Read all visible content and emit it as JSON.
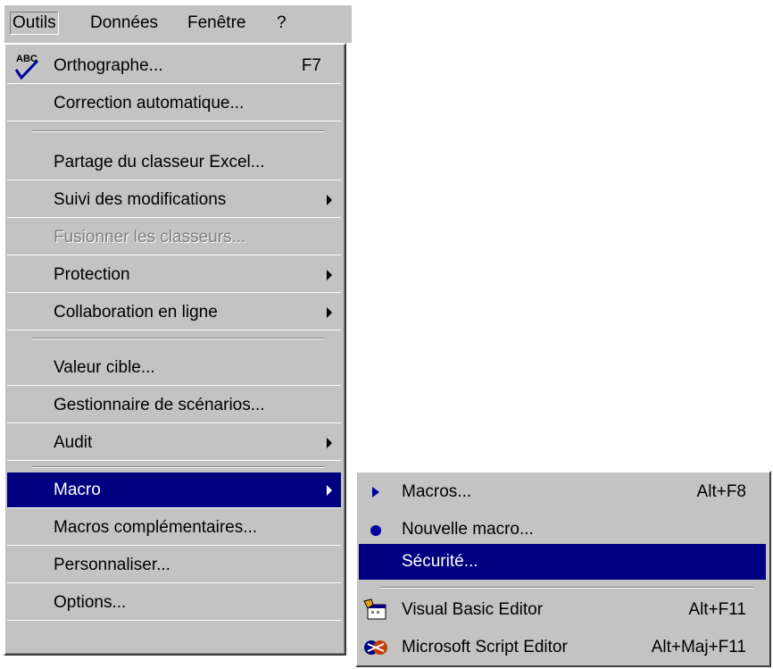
{
  "menubar": {
    "items": [
      {
        "label": "Outils",
        "ul": "O"
      },
      {
        "label": "Données",
        "ul": "D"
      },
      {
        "label": "Fenêtre",
        "ul": "n"
      },
      {
        "label": "?",
        "ul": "?"
      }
    ]
  },
  "menu": {
    "items": [
      {
        "label": "Orthographe...",
        "shortcut": "F7"
      },
      {
        "label": "Correction automatique..."
      },
      {
        "label": "Partage du classeur Excel..."
      },
      {
        "label": "Suivi des modifications"
      },
      {
        "label": "Fusionner les classeurs..."
      },
      {
        "label": "Protection"
      },
      {
        "label": "Collaboration en ligne"
      },
      {
        "label": "Valeur cible..."
      },
      {
        "label": "Gestionnaire de scénarios..."
      },
      {
        "label": "Audit"
      },
      {
        "label": "Macro"
      },
      {
        "label": "Macros complémentaires..."
      },
      {
        "label": "Personnaliser..."
      },
      {
        "label": "Options..."
      }
    ]
  },
  "submenu": {
    "items": [
      {
        "label": "Macros...",
        "shortcut": "Alt+F8"
      },
      {
        "label": "Nouvelle macro..."
      },
      {
        "label": "Sécurité..."
      },
      {
        "label": "Visual Basic Editor",
        "shortcut": "Alt+F11"
      },
      {
        "label": "Microsoft Script Editor",
        "shortcut": "Alt+Maj+F11"
      }
    ]
  },
  "icons": {
    "spelling": "abc-check-icon",
    "macros": "play-triangle-icon",
    "record": "record-dot-icon",
    "vbe": "vba-editor-icon",
    "script": "script-editor-icon"
  },
  "colors": {
    "menu_bg": "#c3c3c3",
    "highlight": "#000080"
  }
}
